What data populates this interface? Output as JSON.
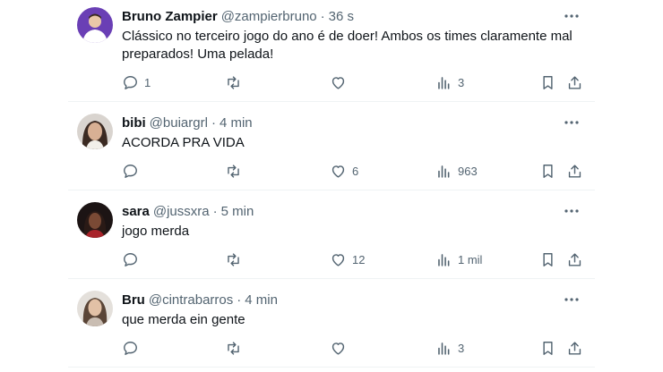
{
  "tweets": [
    {
      "name": "Bruno Zampier",
      "handle": "@zampierbruno",
      "time": "36 s",
      "text": "Clássico no terceiro jogo do ano é de doer! Ambos os times claramente mal preparados! Uma pelada!",
      "replies": "1",
      "retweets": "",
      "likes": "",
      "views": "3"
    },
    {
      "name": "bibi",
      "handle": "@buiargrl",
      "time": "4 min",
      "text": "ACORDA PRA VIDA",
      "replies": "",
      "retweets": "",
      "likes": "6",
      "views": "963"
    },
    {
      "name": "sara",
      "handle": "@jussxra",
      "time": "5 min",
      "text": "jogo merda",
      "replies": "",
      "retweets": "",
      "likes": "12",
      "views": "1 mil"
    },
    {
      "name": "Bru",
      "handle": "@cintrabarros",
      "time": "4 min",
      "text": "que merda ein gente",
      "replies": "",
      "retweets": "",
      "likes": "",
      "views": "3"
    }
  ],
  "separator": "·",
  "colors": {
    "text": "#0f1419",
    "secondary": "#536471",
    "divider": "#eff3f4"
  },
  "icons": [
    "reply-icon",
    "retweet-icon",
    "like-icon",
    "views-icon",
    "bookmark-icon",
    "share-icon",
    "more-icon"
  ]
}
